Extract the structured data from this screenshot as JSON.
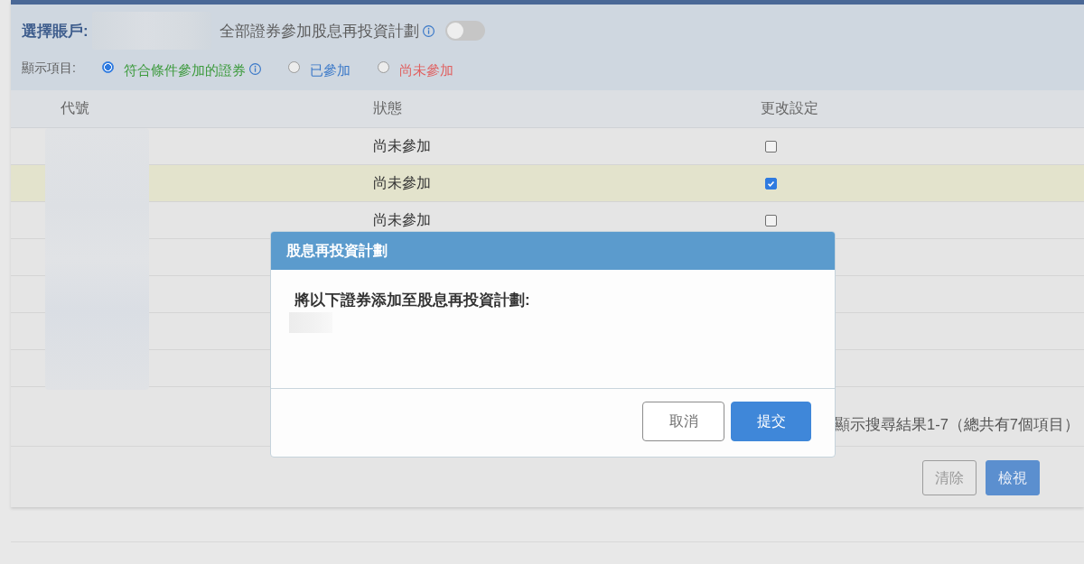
{
  "account_bar": {
    "label": "選擇賬戶:",
    "enroll_all": {
      "label": "全部證券參加股息再投資計劃",
      "on": false
    }
  },
  "filter": {
    "label": "顯示項目:",
    "options": [
      {
        "label": "符合條件參加的證券",
        "selected": true,
        "color": "#3c9a3c",
        "info": true
      },
      {
        "label": "已參加",
        "selected": false,
        "color": "#3a78c8",
        "info": false
      },
      {
        "label": "尚未參加",
        "selected": false,
        "color": "#e06060",
        "info": false
      }
    ]
  },
  "table": {
    "columns": [
      "代號",
      "狀態",
      "更改設定"
    ],
    "rows": [
      {
        "status": "尚未參加",
        "checked": false,
        "selected": false
      },
      {
        "status": "尚未參加",
        "checked": true,
        "selected": true
      },
      {
        "status": "尚未參加",
        "checked": false,
        "selected": false
      },
      {
        "selected": false
      },
      {
        "selected": false
      },
      {
        "selected": false
      },
      {
        "selected": false
      }
    ]
  },
  "results": "顯示搜尋結果1-7（總共有7個項目）",
  "actions": [
    {
      "label": "清除",
      "kind": "secondary"
    },
    {
      "label": "檢視",
      "kind": "primary"
    }
  ],
  "dialog": {
    "title": "股息再投資計劃",
    "message": "將以下證券添加至股息再投資計劃:",
    "buttons": [
      {
        "label": "取消",
        "kind": "secondary"
      },
      {
        "label": "提交",
        "kind": "primary"
      }
    ]
  }
}
